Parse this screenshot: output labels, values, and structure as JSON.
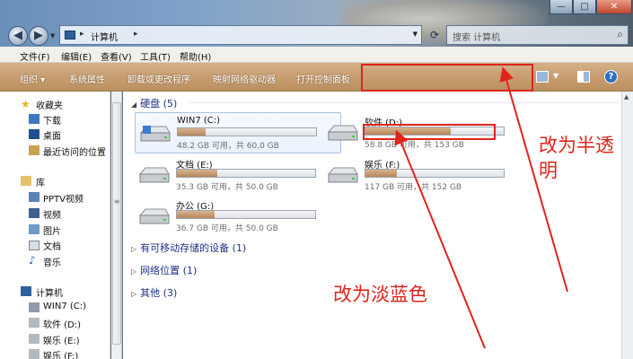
{
  "window": {
    "controls": {
      "minimize": "—",
      "maximize": "□",
      "close": "✕"
    }
  },
  "addressbar": {
    "crumb": "计算机",
    "search_placeholder": "搜索 计算机"
  },
  "menubar": [
    "文件(F)",
    "编辑(E)",
    "查看(V)",
    "工具(T)",
    "帮助(H)"
  ],
  "commandbar": [
    "组织 ▾",
    "系统属性",
    "卸载或更改程序",
    "映射网络驱动器",
    "打开控制面板"
  ],
  "navpane": {
    "favorites": {
      "label": "收藏夹",
      "items": [
        "下载",
        "桌面",
        "最近访问的位置"
      ]
    },
    "libraries": {
      "label": "库",
      "items": [
        "PPTV视频",
        "视频",
        "图片",
        "文档",
        "音乐"
      ]
    },
    "computer": {
      "label": "计算机",
      "items": [
        "WIN7 (C:)",
        "软件 (D:)",
        "娱乐 (E:)",
        "娱乐 (F:)"
      ]
    }
  },
  "content": {
    "groups": {
      "hdd": "硬盘 (5)",
      "removable": "有可移动存储的设备 (1)",
      "network": "网络位置 (1)",
      "other": "其他 (3)"
    },
    "drives": [
      {
        "name": "WIN7 (C:)",
        "info": "48.2 GB 可用，共 60.0 GB",
        "used": 0.2
      },
      {
        "name": "软件 (D:)",
        "info": "58.8 GB 可用，共 153 GB",
        "used": 0.62
      },
      {
        "name": "文档 (E:)",
        "info": "35.3 GB 可用，共 50.0 GB",
        "used": 0.29
      },
      {
        "name": "娱乐 (F:)",
        "info": "117 GB 可用，共 152 GB",
        "used": 0.23
      },
      {
        "name": "办公 (G:)",
        "info": "36.7 GB 可用，共 50.0 GB",
        "used": 0.27
      }
    ]
  },
  "annotations": {
    "translucent": [
      "改为半透",
      "明"
    ],
    "light_blue": "改为淡蓝色"
  },
  "colors": {
    "annotation": "#e0241b",
    "commandbar": "#c89e70",
    "group_heading": "#1e3287"
  }
}
